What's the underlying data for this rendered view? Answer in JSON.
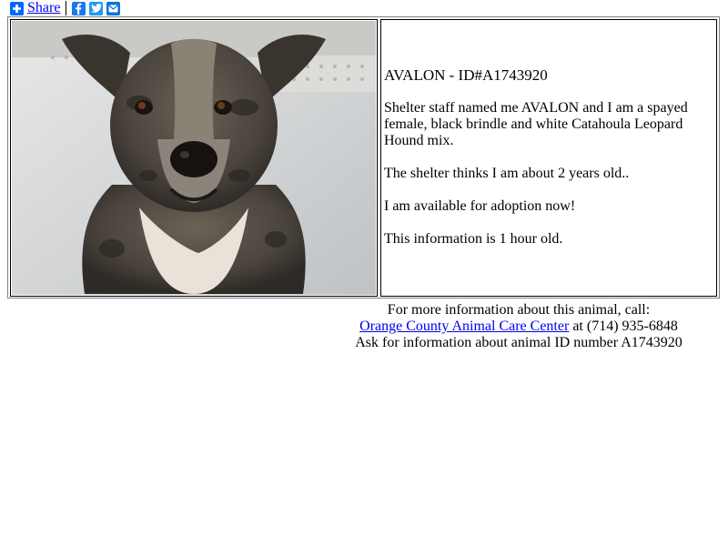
{
  "share": {
    "label": "Share",
    "icons": [
      "plus-icon",
      "facebook-icon",
      "twitter-icon",
      "email-icon"
    ],
    "colors": {
      "plus": "#0166ff",
      "facebook": "#1877f2",
      "twitter": "#1d9bf0",
      "email": "#0b72dd"
    }
  },
  "animal": {
    "title": "AVALON - ID#A1743920",
    "description": "Shelter staff named me AVALON and I am a spayed female, black brindle and white Catahoula Leopard Hound mix.",
    "age": "The shelter thinks I am about 2 years old..",
    "availability": "I am available for adoption now!",
    "freshness": "This information is 1 hour old."
  },
  "footer": {
    "line1": "For more information about this animal, call:",
    "shelter_link": "Orange County Animal Care Center",
    "phone": " at (714) 935-6848",
    "line3": "Ask for information about animal ID number A1743920"
  }
}
